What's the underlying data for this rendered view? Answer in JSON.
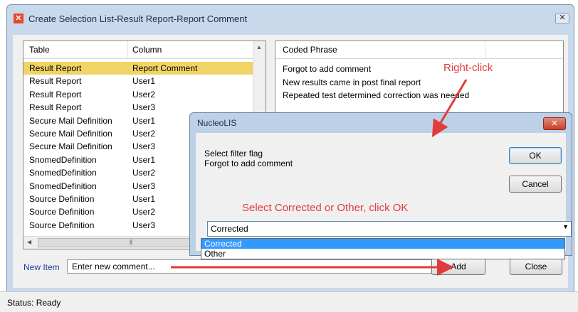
{
  "window": {
    "title": "Create Selection List-Result Report-Report Comment",
    "close_glyph": "✕"
  },
  "left_table": {
    "headers": [
      "Table",
      "Column"
    ],
    "rows": [
      [
        "Result Report",
        "Report Comment"
      ],
      [
        "Result Report",
        "User1"
      ],
      [
        "Result Report",
        "User2"
      ],
      [
        "Result Report",
        "User3"
      ],
      [
        "Secure Mail Definition",
        "User1"
      ],
      [
        "Secure Mail Definition",
        "User2"
      ],
      [
        "Secure Mail Definition",
        "User3"
      ],
      [
        "SnomedDefinition",
        "User1"
      ],
      [
        "SnomedDefinition",
        "User2"
      ],
      [
        "SnomedDefinition",
        "User3"
      ],
      [
        "Source Definition",
        "User1"
      ],
      [
        "Source Definition",
        "User2"
      ],
      [
        "Source Definition",
        "User3"
      ]
    ],
    "selected_row": 0,
    "selected_color": "#f0d466"
  },
  "right_table": {
    "header": "Coded Phrase",
    "rows": [
      "Forgot to add comment",
      "New results came in post final report",
      "Repeated test determined correction was needed"
    ]
  },
  "new_item": {
    "label": "New Item",
    "value": "Enter new comment..."
  },
  "buttons": {
    "add": "Add",
    "close": "Close"
  },
  "status": "Status: Ready",
  "dialog": {
    "title": "NucleoLIS",
    "message_line1": "Select filter flag",
    "message_line2": "Forgot to add comment",
    "ok": "OK",
    "cancel": "Cancel",
    "combo_value": "Corrected",
    "options": [
      "Corrected",
      "Other"
    ],
    "close_glyph": "✕"
  },
  "annotations": {
    "right_click": "Right-click",
    "select_instruction": "Select Corrected or Other, click OK",
    "color": "#e23b3b"
  }
}
